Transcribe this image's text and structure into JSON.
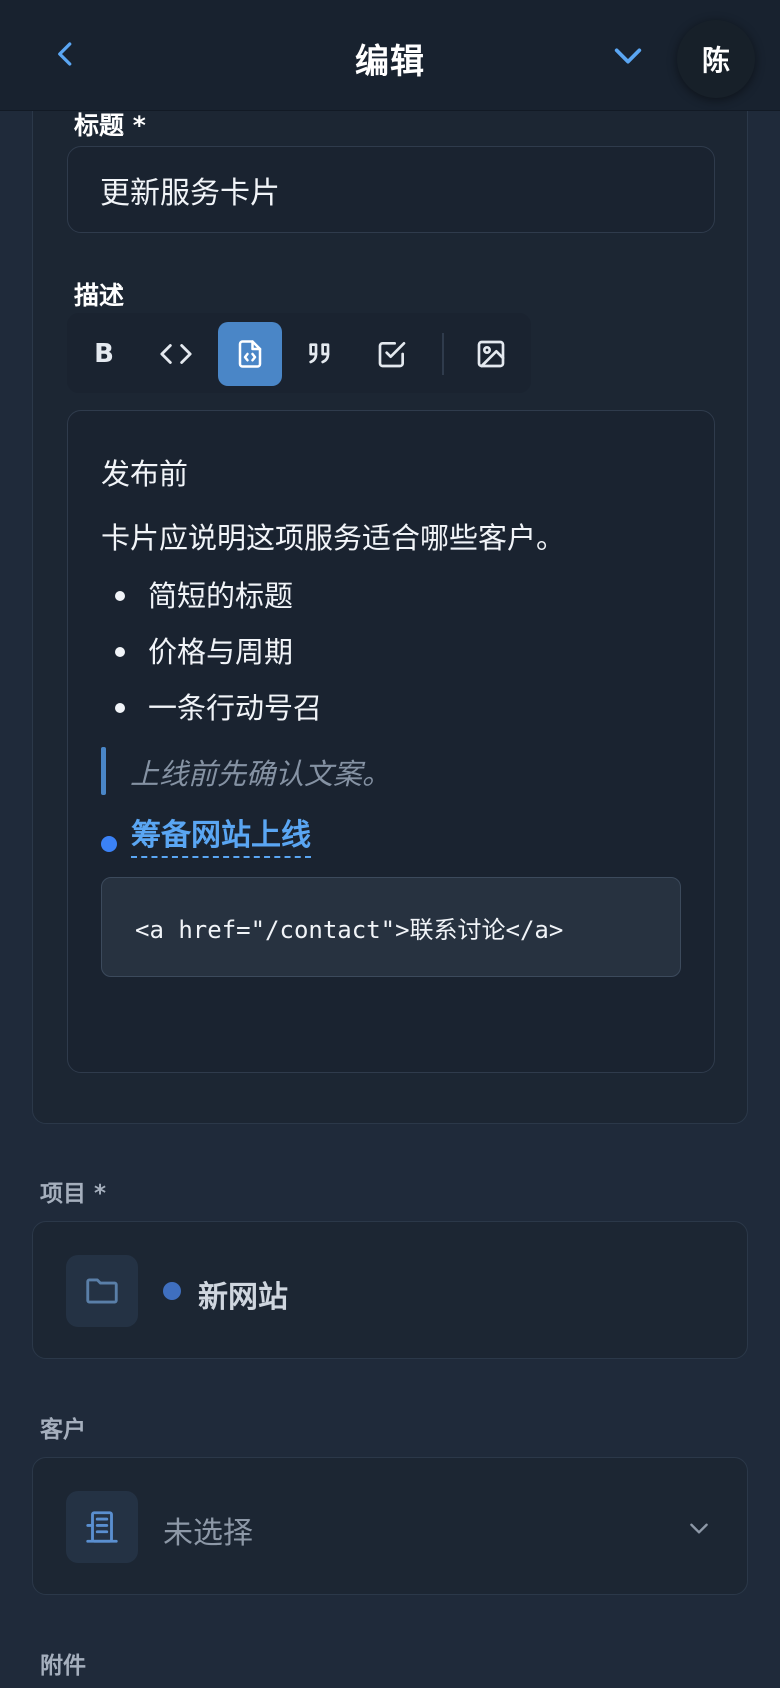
{
  "header": {
    "title": "编辑",
    "avatar_initial": "陈"
  },
  "form": {
    "title_label": "标题 *",
    "title_value": "更新服务卡片",
    "desc_label": "描述",
    "toolbar": {
      "bold_label": "B",
      "code_label": "<>"
    },
    "content": {
      "heading": "发布前",
      "paragraph": "卡片应说明这项服务适合哪些客户。",
      "list": [
        "简短的标题",
        "价格与周期",
        "一条行动号召"
      ],
      "quote": "上线前先确认文案。",
      "link": "筹备网站上线",
      "code": "<a href=\"/contact\">联系讨论</a>"
    },
    "project_label": "项目 *",
    "project_value": "新网站",
    "client_label": "客户",
    "client_value": "未选择",
    "attachments_label": "附件"
  },
  "colors": {
    "accent": "#4a86c7",
    "link": "#5aa6f3",
    "background": "#1f2a3a"
  }
}
